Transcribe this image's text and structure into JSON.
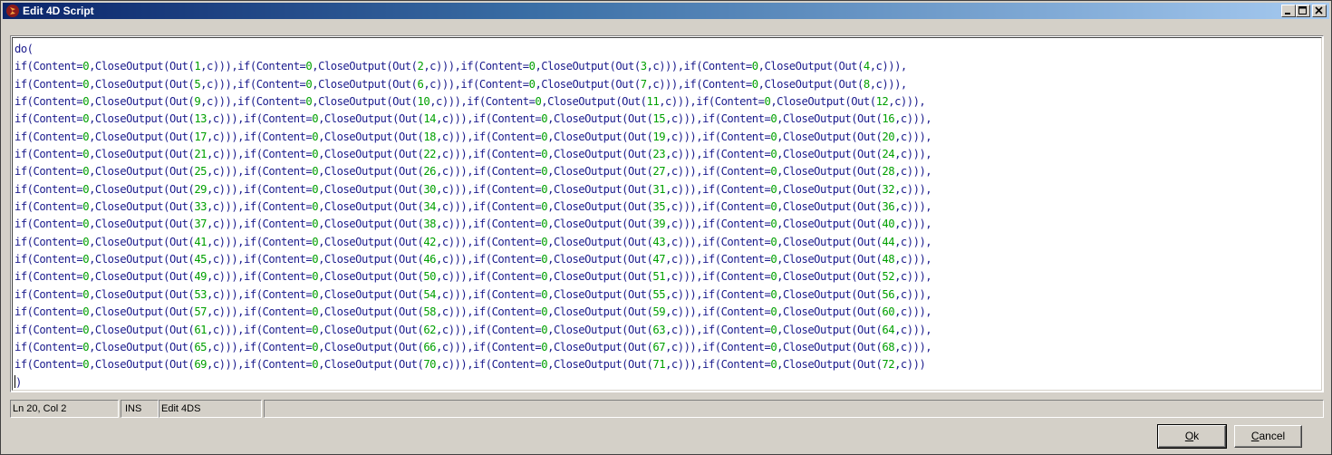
{
  "window": {
    "title": "Edit 4D Script"
  },
  "titlebar_buttons": [
    "minimize",
    "maximize",
    "close"
  ],
  "script": {
    "lines": [
      "do(",
      "if(Content=0,CloseOutput(Out(1,c))),if(Content=0,CloseOutput(Out(2,c))),if(Content=0,CloseOutput(Out(3,c))),if(Content=0,CloseOutput(Out(4,c))),",
      "if(Content=0,CloseOutput(Out(5,c))),if(Content=0,CloseOutput(Out(6,c))),if(Content=0,CloseOutput(Out(7,c))),if(Content=0,CloseOutput(Out(8,c))),",
      "if(Content=0,CloseOutput(Out(9,c))),if(Content=0,CloseOutput(Out(10,c))),if(Content=0,CloseOutput(Out(11,c))),if(Content=0,CloseOutput(Out(12,c))),",
      "if(Content=0,CloseOutput(Out(13,c))),if(Content=0,CloseOutput(Out(14,c))),if(Content=0,CloseOutput(Out(15,c))),if(Content=0,CloseOutput(Out(16,c))),",
      "if(Content=0,CloseOutput(Out(17,c))),if(Content=0,CloseOutput(Out(18,c))),if(Content=0,CloseOutput(Out(19,c))),if(Content=0,CloseOutput(Out(20,c))),",
      "if(Content=0,CloseOutput(Out(21,c))),if(Content=0,CloseOutput(Out(22,c))),if(Content=0,CloseOutput(Out(23,c))),if(Content=0,CloseOutput(Out(24,c))),",
      "if(Content=0,CloseOutput(Out(25,c))),if(Content=0,CloseOutput(Out(26,c))),if(Content=0,CloseOutput(Out(27,c))),if(Content=0,CloseOutput(Out(28,c))),",
      "if(Content=0,CloseOutput(Out(29,c))),if(Content=0,CloseOutput(Out(30,c))),if(Content=0,CloseOutput(Out(31,c))),if(Content=0,CloseOutput(Out(32,c))),",
      "if(Content=0,CloseOutput(Out(33,c))),if(Content=0,CloseOutput(Out(34,c))),if(Content=0,CloseOutput(Out(35,c))),if(Content=0,CloseOutput(Out(36,c))),",
      "if(Content=0,CloseOutput(Out(37,c))),if(Content=0,CloseOutput(Out(38,c))),if(Content=0,CloseOutput(Out(39,c))),if(Content=0,CloseOutput(Out(40,c))),",
      "if(Content=0,CloseOutput(Out(41,c))),if(Content=0,CloseOutput(Out(42,c))),if(Content=0,CloseOutput(Out(43,c))),if(Content=0,CloseOutput(Out(44,c))),",
      "if(Content=0,CloseOutput(Out(45,c))),if(Content=0,CloseOutput(Out(46,c))),if(Content=0,CloseOutput(Out(47,c))),if(Content=0,CloseOutput(Out(48,c))),",
      "if(Content=0,CloseOutput(Out(49,c))),if(Content=0,CloseOutput(Out(50,c))),if(Content=0,CloseOutput(Out(51,c))),if(Content=0,CloseOutput(Out(52,c))),",
      "if(Content=0,CloseOutput(Out(53,c))),if(Content=0,CloseOutput(Out(54,c))),if(Content=0,CloseOutput(Out(55,c))),if(Content=0,CloseOutput(Out(56,c))),",
      "if(Content=0,CloseOutput(Out(57,c))),if(Content=0,CloseOutput(Out(58,c))),if(Content=0,CloseOutput(Out(59,c))),if(Content=0,CloseOutput(Out(60,c))),",
      "if(Content=0,CloseOutput(Out(61,c))),if(Content=0,CloseOutput(Out(62,c))),if(Content=0,CloseOutput(Out(63,c))),if(Content=0,CloseOutput(Out(64,c))),",
      "if(Content=0,CloseOutput(Out(65,c))),if(Content=0,CloseOutput(Out(66,c))),if(Content=0,CloseOutput(Out(67,c))),if(Content=0,CloseOutput(Out(68,c))),",
      "if(Content=0,CloseOutput(Out(69,c))),if(Content=0,CloseOutput(Out(70,c))),if(Content=0,CloseOutput(Out(71,c))),if(Content=0,CloseOutput(Out(72,c)))",
      ")"
    ],
    "colors": {
      "code": "#1a1a8c",
      "number": "#00a000"
    }
  },
  "statusbar": {
    "position": "Ln 20, Col 2",
    "mode": "INS",
    "label": "Edit 4DS"
  },
  "buttons": {
    "ok": {
      "mnemonic": "O",
      "rest": "k"
    },
    "cancel": {
      "mnemonic": "C",
      "rest": "ancel"
    }
  }
}
